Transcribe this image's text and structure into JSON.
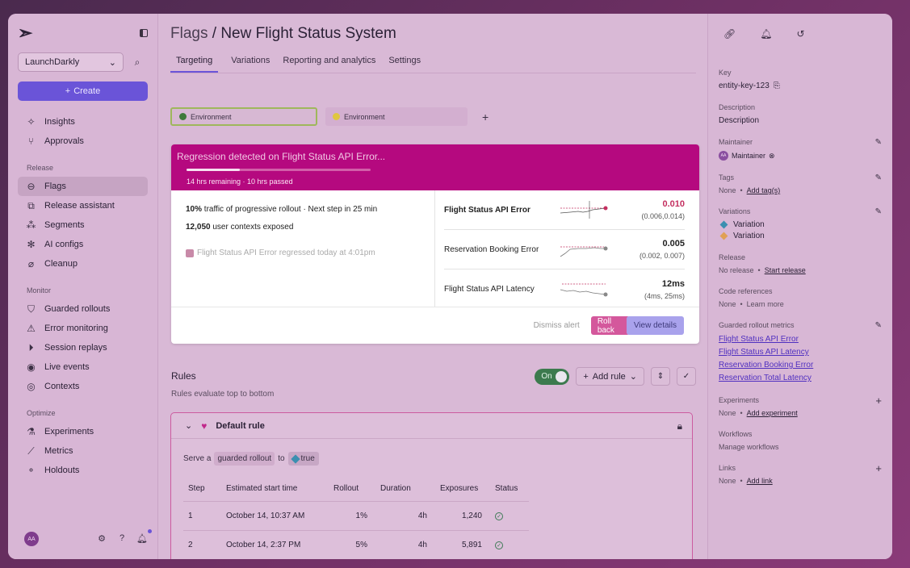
{
  "sidebar": {
    "project": "LaunchDarkly",
    "create_label": "Create",
    "top_items": [
      {
        "label": "Insights",
        "icon": "sparkle-icon"
      },
      {
        "label": "Approvals",
        "icon": "branch-icon"
      }
    ],
    "release_heading": "Release",
    "release_items": [
      {
        "label": "Flags",
        "icon": "toggle-icon"
      },
      {
        "label": "Release assistant",
        "icon": "layers-icon"
      },
      {
        "label": "Segments",
        "icon": "segments-icon"
      },
      {
        "label": "AI configs",
        "icon": "ai-icon"
      },
      {
        "label": "Cleanup",
        "icon": "broom-icon"
      }
    ],
    "monitor_heading": "Monitor",
    "monitor_items": [
      {
        "label": "Guarded rollouts",
        "icon": "shield-icon"
      },
      {
        "label": "Error monitoring",
        "icon": "warning-icon"
      },
      {
        "label": "Session replays",
        "icon": "play-icon"
      },
      {
        "label": "Live events",
        "icon": "radio-icon"
      },
      {
        "label": "Contexts",
        "icon": "fingerprint-icon"
      }
    ],
    "optimize_heading": "Optimize",
    "optimize_items": [
      {
        "label": "Experiments",
        "icon": "flask-icon"
      },
      {
        "label": "Metrics",
        "icon": "ruler-icon"
      },
      {
        "label": "Holdouts",
        "icon": "holdout-icon"
      }
    ],
    "avatar": "AA"
  },
  "header": {
    "crumb": "Flags",
    "separator": "/",
    "title": "New Flight Status System",
    "tabs": [
      "Targeting",
      "Variations",
      "Reporting and analytics",
      "Settings"
    ]
  },
  "environments": [
    {
      "label": "Environment",
      "color": "#3f7a3a"
    },
    {
      "label": "Environment",
      "color": "#e0c740"
    }
  ],
  "alert": {
    "title": "Regression detected on Flight Status API Error...",
    "progress": 0.29,
    "remaining": "14 hrs remaining · 10 hrs passed",
    "traffic_bold": "10%",
    "traffic_text": " traffic of progressive rollout · Next step in 25 min",
    "contexts_bold": "12,050",
    "contexts_text": " user contexts exposed",
    "event_text": "Flight Status API Error regressed today at 4:01pm",
    "metrics": [
      {
        "name": "Flight Status API Error",
        "value": "0.010",
        "range": "(0.006,0.014)"
      },
      {
        "name": "Reservation Booking Error",
        "value": "0.005",
        "range": "(0.002, 0.007)"
      },
      {
        "name": "Flight Status API Latency",
        "value": "12ms",
        "range": "(4ms, 25ms)"
      }
    ],
    "dismiss": "Dismiss alert",
    "rollback": "Roll back",
    "view_details": "View details"
  },
  "rules": {
    "title": "Rules",
    "subtitle": "Rules evaluate top to bottom",
    "toggle": "On",
    "add_rule": "Add rule",
    "default_rule": "Default rule",
    "serve_prefix": "Serve a",
    "serve_pill": "guarded rollout",
    "serve_to": "to",
    "serve_value": "true",
    "columns": [
      "Step",
      "Estimated start time",
      "Rollout",
      "Duration",
      "Exposures",
      "Status"
    ],
    "rows": [
      [
        "1",
        "October 14, 10:37 AM",
        "1%",
        "4h",
        "1,240"
      ],
      [
        "2",
        "October 14, 2:37 PM",
        "5%",
        "4h",
        "5,891"
      ]
    ]
  },
  "rpanel": {
    "key_label": "Key",
    "key_value": "entity-key-123",
    "desc_label": "Description",
    "desc_value": "Description",
    "maint_label": "Maintainer",
    "maint_value": "Maintainer",
    "maint_initials": "AA",
    "tags_label": "Tags",
    "tags_none": "None",
    "tags_add": "Add tag(s)",
    "variations_label": "Variations",
    "variation_1": "Variation",
    "variation_2": "Variation",
    "release_label": "Release",
    "release_none": "No release",
    "release_start": "Start release",
    "code_label": "Code references",
    "code_none": "None",
    "code_learn": "Learn more",
    "grm_label": "Guarded rollout metrics",
    "grm_items": [
      "Flight Status API Error",
      "Flight Status API Latency",
      "Reservation Booking Error",
      "Reservation Total Latency"
    ],
    "exp_label": "Experiments",
    "exp_none": "None",
    "exp_add": "Add experiment",
    "wf_label": "Workflows",
    "wf_value": "Manage workflows",
    "links_label": "Links",
    "links_none": "None",
    "links_add": "Add link"
  }
}
